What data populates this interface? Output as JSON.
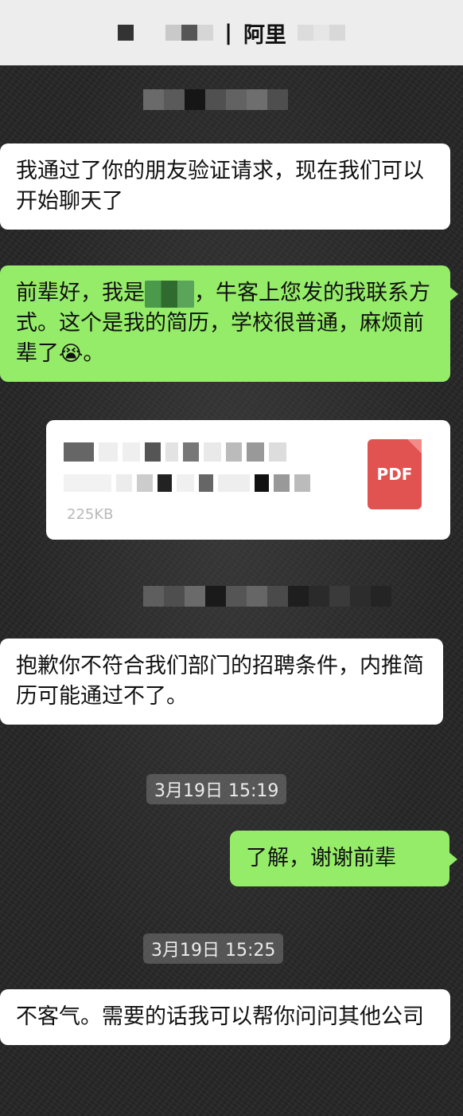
{
  "header": {
    "contact_name": "阿里",
    "separator": "|"
  },
  "messages": [
    {
      "side": "left",
      "text": "我通过了你的朋友验证请求，现在我们可以开始聊天了"
    },
    {
      "side": "right",
      "text_part1": "前辈好，我是",
      "text_part2": "，牛客上您发的我联系方式。这个是我的简历，学校很普通，麻烦前辈了",
      "emoji": "😭",
      "text_end": "。"
    },
    {
      "side": "right",
      "type": "file",
      "file_size": "225KB",
      "file_type": "PDF"
    },
    {
      "side": "left",
      "text": "抱歉你不符合我们部门的招聘条件，内推简历可能通过不了。"
    },
    {
      "side": "right",
      "text": "了解，谢谢前辈"
    },
    {
      "side": "left",
      "text": "不客气。需要的话我可以帮你问问其他公司"
    }
  ],
  "timestamps": [
    "3月19日 15:19",
    "3月19日 15:25"
  ],
  "colors": {
    "my_bubble": "#95ec69",
    "their_bubble": "#ffffff",
    "header_bg": "#ededed",
    "pdf_icon": "#e05350"
  }
}
